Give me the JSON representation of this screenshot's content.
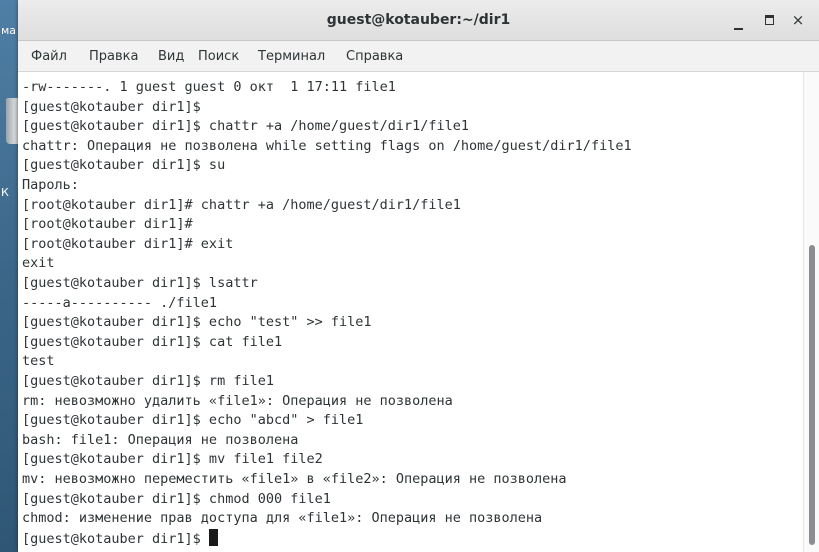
{
  "desktop": {
    "labels": [
      "ма",
      "К"
    ]
  },
  "window": {
    "title": "guest@kotauber:~/dir1",
    "controls": {
      "minimize": "minimize-icon",
      "maximize": "maximize-icon",
      "close": "×"
    }
  },
  "menu": {
    "items": [
      "Файл",
      "Правка",
      "Вид",
      "Поиск",
      "Терминал",
      "Справка"
    ]
  },
  "terminal": {
    "lines": [
      "-rw-------. 1 guest guest 0 окт  1 17:11 file1",
      "[guest@kotauber dir1]$",
      "[guest@kotauber dir1]$ chattr +a /home/guest/dir1/file1",
      "chattr: Операция не позволена while setting flags on /home/guest/dir1/file1",
      "[guest@kotauber dir1]$ su",
      "Пароль:",
      "[root@kotauber dir1]# chattr +a /home/guest/dir1/file1",
      "[root@kotauber dir1]#",
      "[root@kotauber dir1]# exit",
      "exit",
      "[guest@kotauber dir1]$ lsattr",
      "-----a---------- ./file1",
      "[guest@kotauber dir1]$ echo \"test\" >> file1",
      "[guest@kotauber dir1]$ cat file1",
      "test",
      "[guest@kotauber dir1]$ rm file1",
      "rm: невозможно удалить «file1»: Операция не позволена",
      "[guest@kotauber dir1]$ echo \"abcd\" > file1",
      "bash: file1: Операция не позволена",
      "[guest@kotauber dir1]$ mv file1 file2",
      "mv: невозможно переместить «file1» в «file2»: Операция не позволена",
      "[guest@kotauber dir1]$ chmod 000 file1",
      "chmod: изменение прав доступа для «file1»: Операция не позволена"
    ],
    "prompt": "[guest@kotauber dir1]$ "
  }
}
